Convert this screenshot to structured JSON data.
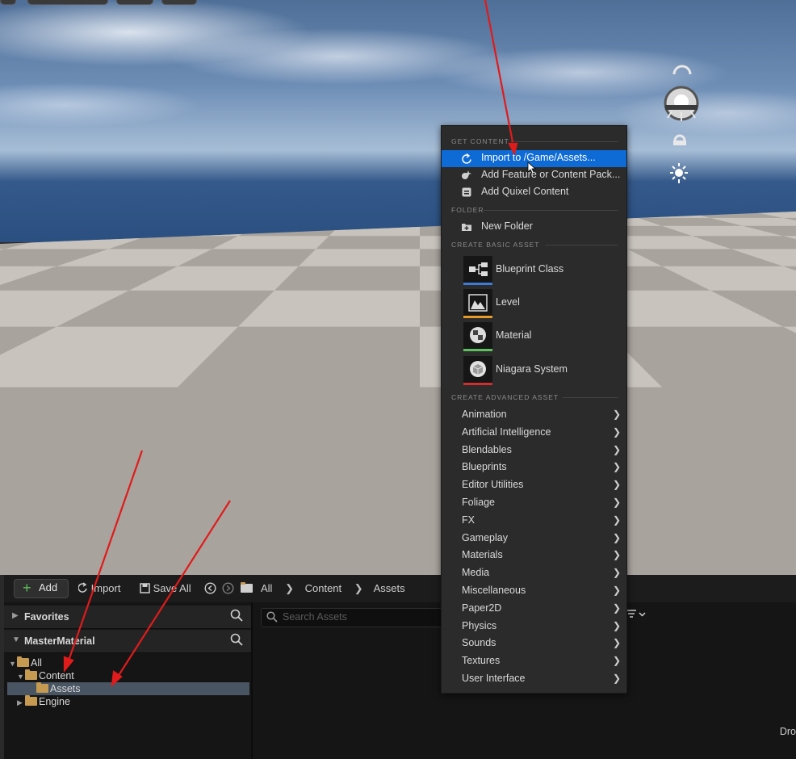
{
  "menu": {
    "sections": {
      "get_content": "GET CONTENT",
      "folder": "FOLDER",
      "basic": "CREATE BASIC ASSET",
      "advanced": "CREATE ADVANCED ASSET"
    },
    "get_content_items": [
      {
        "label": "Import to /Game/Assets...",
        "icon": "import-icon",
        "highlighted": true
      },
      {
        "label": "Add Feature or Content Pack...",
        "icon": "feature-pack-icon"
      },
      {
        "label": "Add Quixel Content",
        "icon": "quixel-icon"
      }
    ],
    "folder_items": [
      {
        "label": "New Folder",
        "icon": "new-folder-icon"
      }
    ],
    "basic_assets": [
      {
        "label": "Blueprint Class",
        "icon": "blueprint-class-icon",
        "color": "#3d7bd6"
      },
      {
        "label": "Level",
        "icon": "level-icon",
        "color": "#e69a2a"
      },
      {
        "label": "Material",
        "icon": "material-icon",
        "color": "#5cc15c"
      },
      {
        "label": "Niagara System",
        "icon": "niagara-system-icon",
        "color": "#d12e2e"
      }
    ],
    "advanced_assets": [
      "Animation",
      "Artificial Intelligence",
      "Blendables",
      "Blueprints",
      "Editor Utilities",
      "Foliage",
      "FX",
      "Gameplay",
      "Materials",
      "Media",
      "Miscellaneous",
      "Paper2D",
      "Physics",
      "Sounds",
      "Textures",
      "User Interface"
    ]
  },
  "toolbar": {
    "add_label": "Add",
    "import_label": "Import",
    "save_all_label": "Save All",
    "breadcrumb": [
      "All",
      "Content",
      "Assets"
    ]
  },
  "left_pane": {
    "favorites_label": "Favorites",
    "collection_label": "MasterMaterial",
    "tree": [
      {
        "label": "All",
        "level": 0,
        "expanded": true
      },
      {
        "label": "Content",
        "level": 1,
        "expanded": true
      },
      {
        "label": "Assets",
        "level": 2,
        "selected": true
      },
      {
        "label": "Engine",
        "level": 1,
        "expanded": false
      }
    ]
  },
  "right_pane": {
    "search_placeholder": "Search Assets",
    "drop_hint": "Dro"
  },
  "colors": {
    "highlight": "#0e6bd6",
    "annotation_arrow": "#e01b1b"
  }
}
